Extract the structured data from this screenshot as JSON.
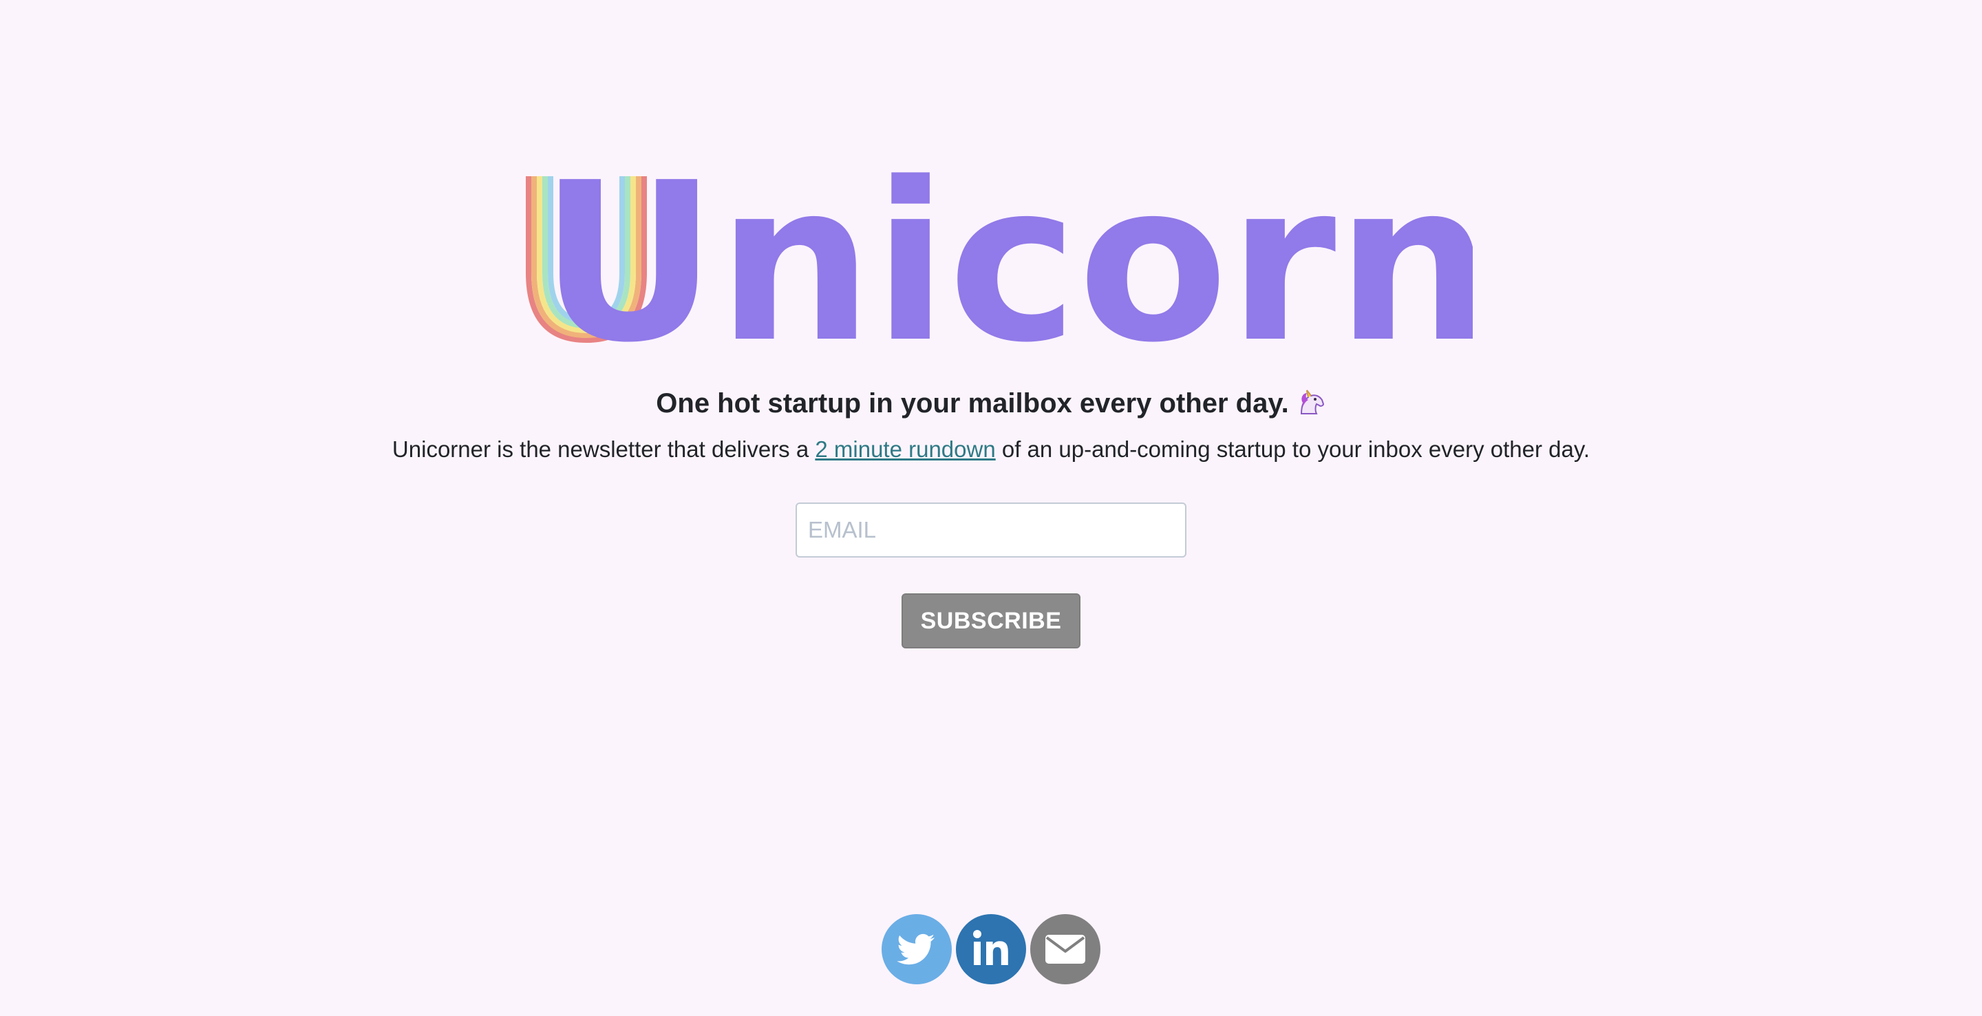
{
  "brand": {
    "logo_text": "Unicorner",
    "logo_color": "#917ae9",
    "rainbow_colors": [
      "#e88383",
      "#f0b27a",
      "#f5e58a",
      "#a9e4c2",
      "#9fd3ec",
      "#b9a6f2"
    ]
  },
  "hero": {
    "headline": "One hot startup in your mailbox every other day.",
    "headline_emoji": "unicorn-emoji",
    "description_before": "Unicorner is the newsletter that delivers a ",
    "description_link": "2 minute rundown",
    "description_after": " of an up-and-coming startup to your inbox every other day."
  },
  "signup": {
    "email_placeholder": "EMAIL",
    "email_value": "",
    "subscribe_label": "SUBSCRIBE",
    "button_color": "#8a8a8a"
  },
  "social": [
    {
      "name": "twitter",
      "icon": "twitter-bird-icon",
      "color": "#6aaee6"
    },
    {
      "name": "linkedin",
      "icon": "linkedin-icon",
      "color": "#2d74b1"
    },
    {
      "name": "email",
      "icon": "envelope-icon",
      "color": "#808080"
    }
  ],
  "colors": {
    "background": "#fcf4fc",
    "text": "#212429",
    "link": "#2e7a86"
  }
}
